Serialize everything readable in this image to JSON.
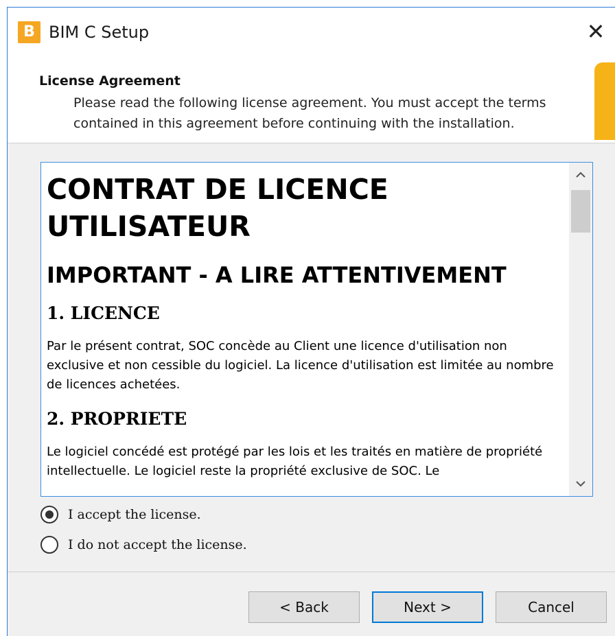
{
  "window": {
    "title": "BIM C Setup",
    "app_icon_letter": "B",
    "close_glyph": "✕"
  },
  "header": {
    "title": "License Agreement",
    "description": "Please read the following license agreement. You must accept the terms contained in this agreement before continuing with the installation."
  },
  "license": {
    "heading1": "CONTRAT DE LICENCE UTILISATEUR",
    "heading2": "IMPORTANT - A LIRE ATTENTIVEMENT",
    "section1_title": "1. LICENCE",
    "section1_text": "Par le présent contrat, SOC concède au Client une licence d'utilisation non exclusive et non cessible du logiciel. La licence d'utilisation est limitée au nombre de licences achetées.",
    "section2_title": "2. PROPRIETE",
    "section2_text": "Le logiciel concédé est protégé par les lois et les traités en matière de propriété intellectuelle. Le logiciel reste la propriété exclusive de SOC. Le"
  },
  "options": {
    "accept_label": "I accept the license.",
    "decline_label": "I do not accept the license.",
    "selected": "accept"
  },
  "buttons": {
    "back": "< Back",
    "next": "Next >",
    "cancel": "Cancel"
  },
  "colors": {
    "accent": "#f6b318",
    "focus_border": "#0078d7"
  },
  "icons": {
    "app": "bim-c-logo",
    "close": "close-icon",
    "scroll_up": "chevron-up-icon",
    "scroll_down": "chevron-down-icon"
  }
}
